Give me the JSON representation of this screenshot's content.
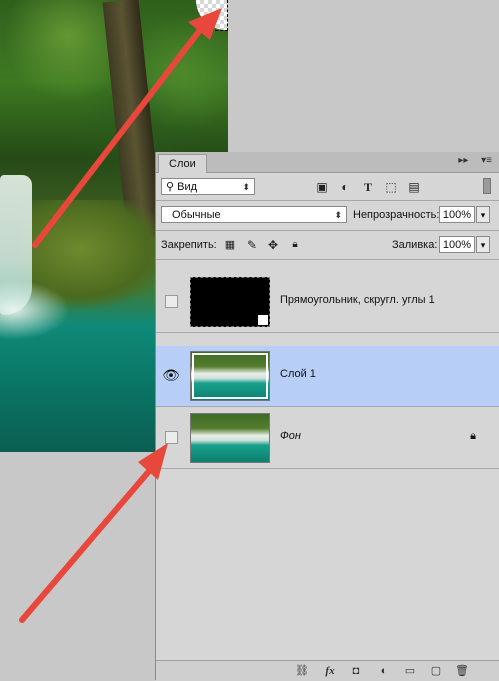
{
  "panel": {
    "tab_title": "Слои",
    "menu_icons": [
      "▸▸",
      "▾≡"
    ],
    "filter": {
      "label": "Вид"
    },
    "blend_mode": "Обычные",
    "opacity_label": "Непрозрачность:",
    "opacity_value": "100%",
    "lock_label": "Закрепить:",
    "fill_label": "Заливка:",
    "fill_value": "100%"
  },
  "layers": [
    {
      "name": "Прямоугольник, скругл. углы 1",
      "visible": false,
      "selected": false,
      "locked": false,
      "thumbnail": "black-shape"
    },
    {
      "name": "Слой 1",
      "visible": true,
      "selected": true,
      "locked": false,
      "thumbnail": "waterfall-photo"
    },
    {
      "name": "Фон",
      "visible": false,
      "selected": false,
      "locked": true,
      "thumbnail": "waterfall-photo"
    }
  ],
  "colors": {
    "selected_layer": "#b7cef7",
    "arrow": "#e8473c"
  }
}
